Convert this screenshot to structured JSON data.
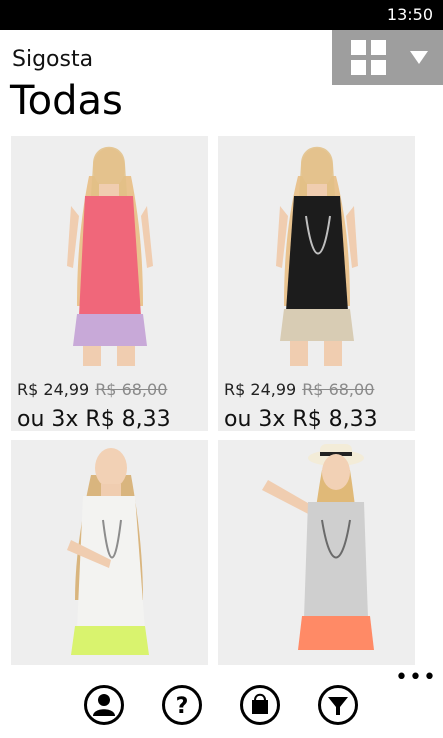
{
  "status": {
    "time": "13:50"
  },
  "header": {
    "app_title": "Sigosta",
    "page_title": "Todas"
  },
  "products": [
    {
      "price": "R$ 24,99",
      "old_price": "R$ 68,00",
      "installment": "ou 3x R$ 8,33",
      "top_color": "#f0677a",
      "bottom_color": "#c8a9d8"
    },
    {
      "price": "R$ 24,99",
      "old_price": "R$ 68,00",
      "installment": "ou 3x R$ 8,33",
      "top_color": "#1c1c1c",
      "bottom_color": "#d8ccb4"
    },
    {
      "top_color": "#f3f3f1",
      "bottom_color": "#d9f36e"
    },
    {
      "top_color": "#cfcfcf",
      "bottom_color": "#ff8a66"
    }
  ],
  "appbar": {
    "buttons": [
      {
        "icon": "user-icon"
      },
      {
        "icon": "help-icon"
      },
      {
        "icon": "shopping-bag-icon"
      },
      {
        "icon": "filter-icon"
      }
    ],
    "more_label": "•••"
  }
}
